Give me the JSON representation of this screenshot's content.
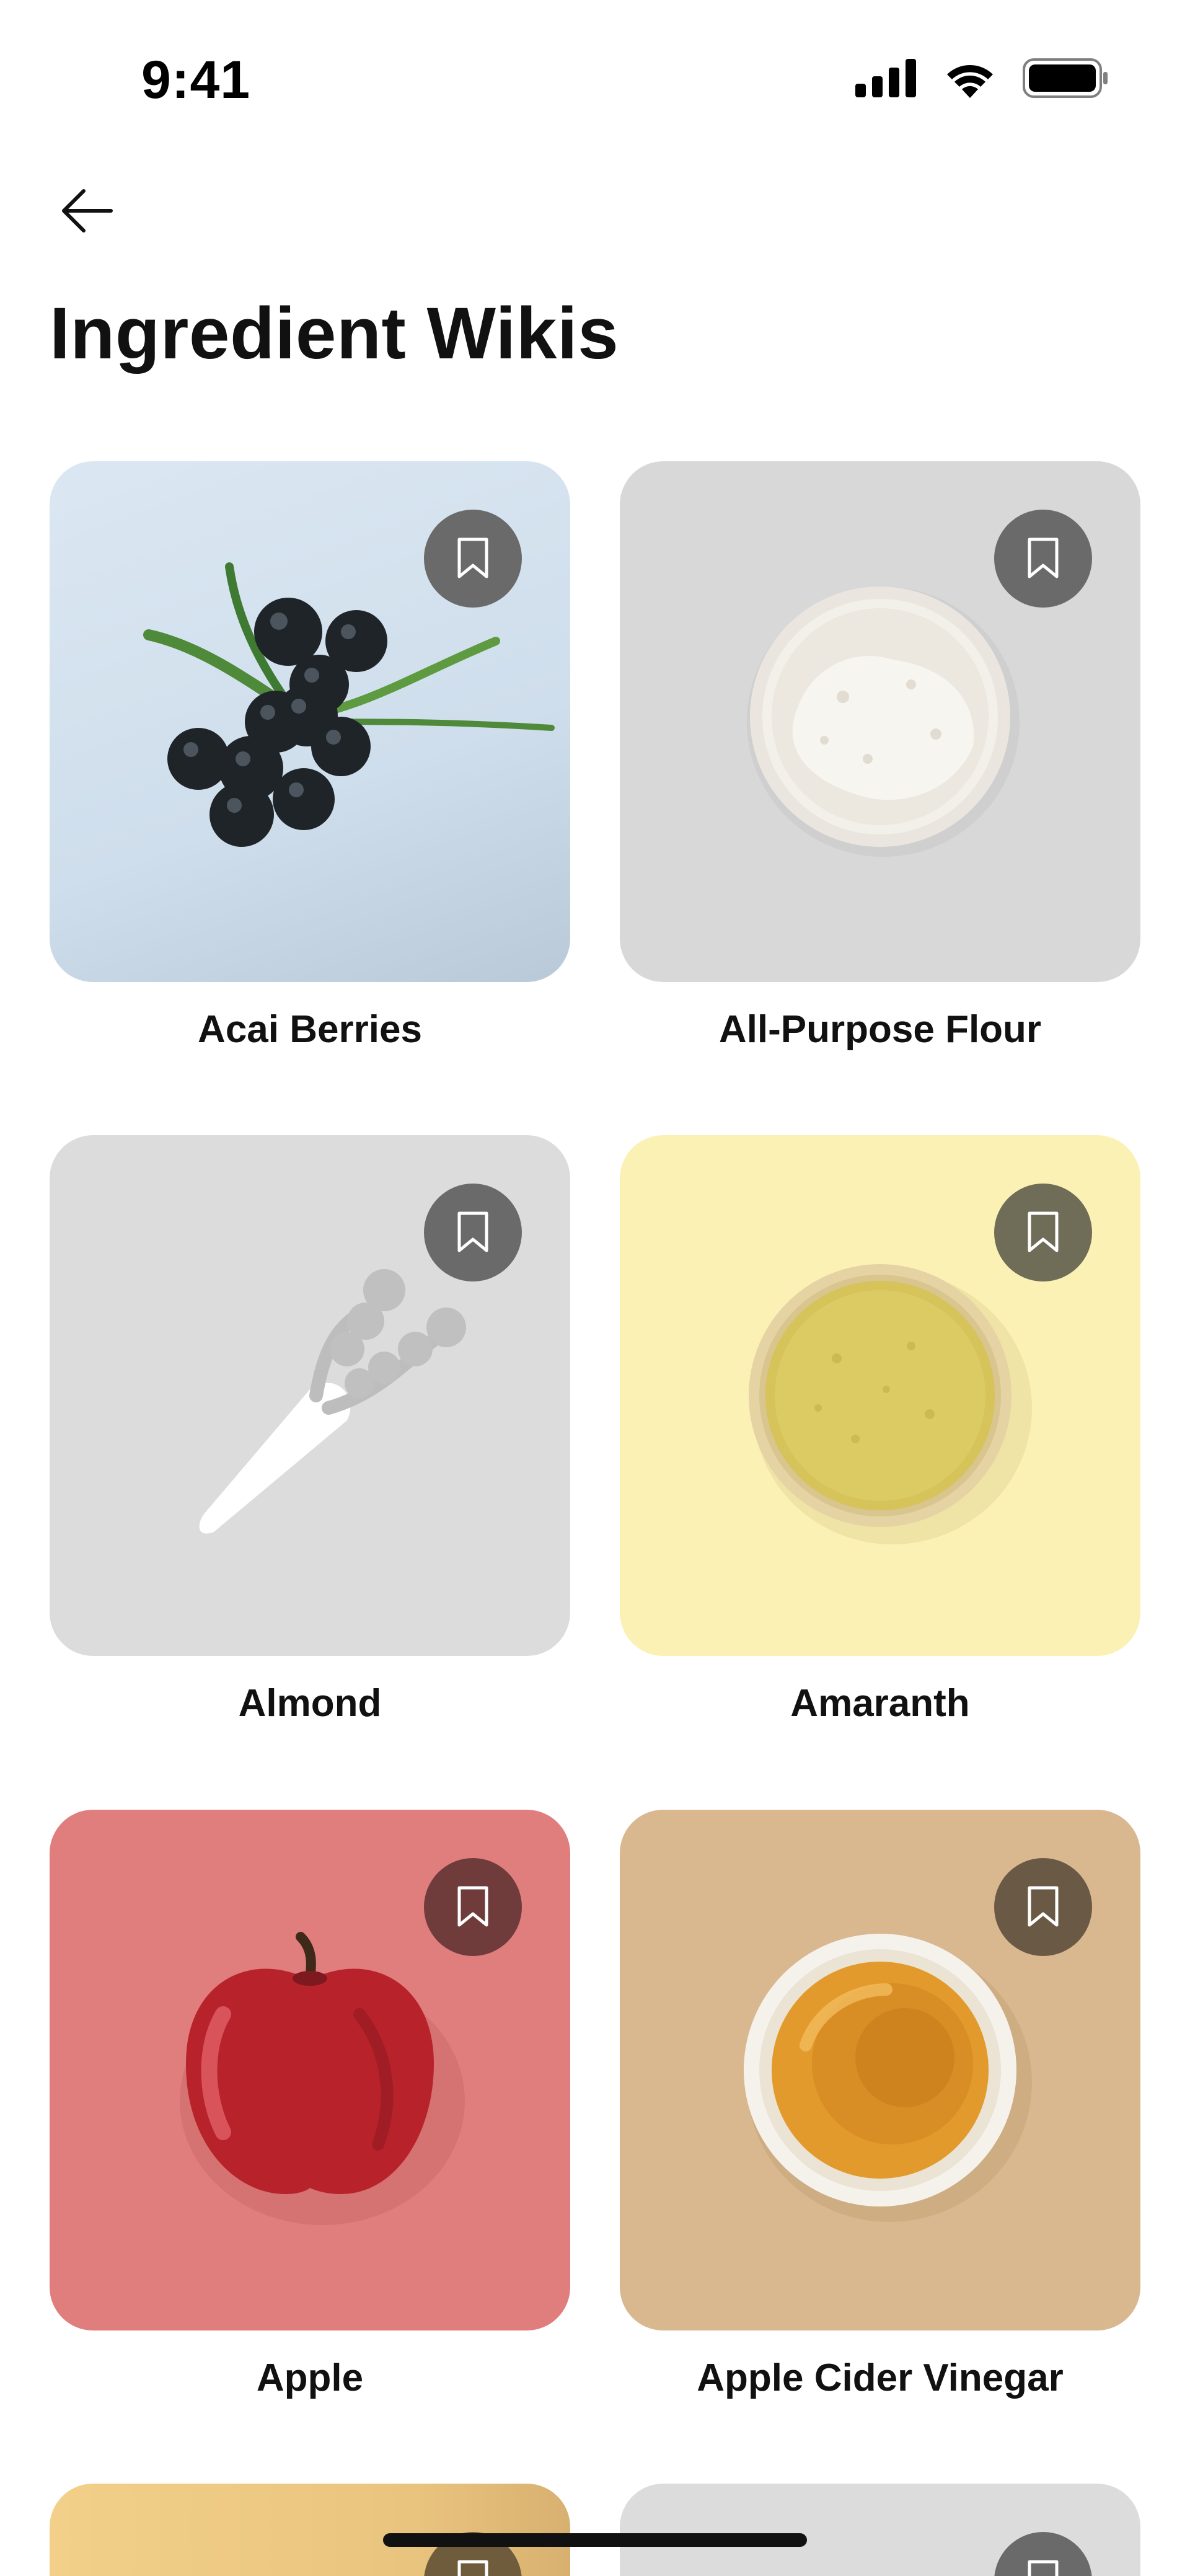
{
  "status_bar": {
    "time": "9:41",
    "icons": [
      "cellular-signal-icon",
      "wifi-icon",
      "battery-icon"
    ]
  },
  "header": {
    "back_icon": "arrow-left-icon",
    "title": "Ingredient Wikis"
  },
  "ingredients": [
    {
      "name": "Acai Berries",
      "bg": "#d3e2ef",
      "bookmark_bg": "#6a6a6a",
      "icon": "bookmark-icon"
    },
    {
      "name": "All-Purpose Flour",
      "bg": "#d8d8d8",
      "bookmark_bg": "#6a6a6a",
      "icon": "bookmark-icon"
    },
    {
      "name": "Almond",
      "bg": "#dcdcdc",
      "bookmark_bg": "#6a6a6a",
      "icon": "bookmark-icon"
    },
    {
      "name": "Amaranth",
      "bg": "#fbf1b4",
      "bookmark_bg": "#6f6c58",
      "icon": "bookmark-icon"
    },
    {
      "name": "Apple",
      "bg": "#e07d7d",
      "bookmark_bg": "#6f3b3b",
      "icon": "bookmark-icon"
    },
    {
      "name": "Apple Cider Vinegar",
      "bg": "#d9b890",
      "bookmark_bg": "#6a5a45",
      "icon": "bookmark-icon"
    },
    {
      "name": "",
      "bg": "#f2d08a",
      "bookmark_bg": "#6e5c3d",
      "icon": "bookmark-icon"
    },
    {
      "name": "",
      "bg": "#dcdcdc",
      "bookmark_bg": "#6a6a6a",
      "icon": "bookmark-icon"
    }
  ],
  "colors": {
    "text": "#111111",
    "background": "#ffffff",
    "bookmark_glyph": "#ffffff"
  }
}
